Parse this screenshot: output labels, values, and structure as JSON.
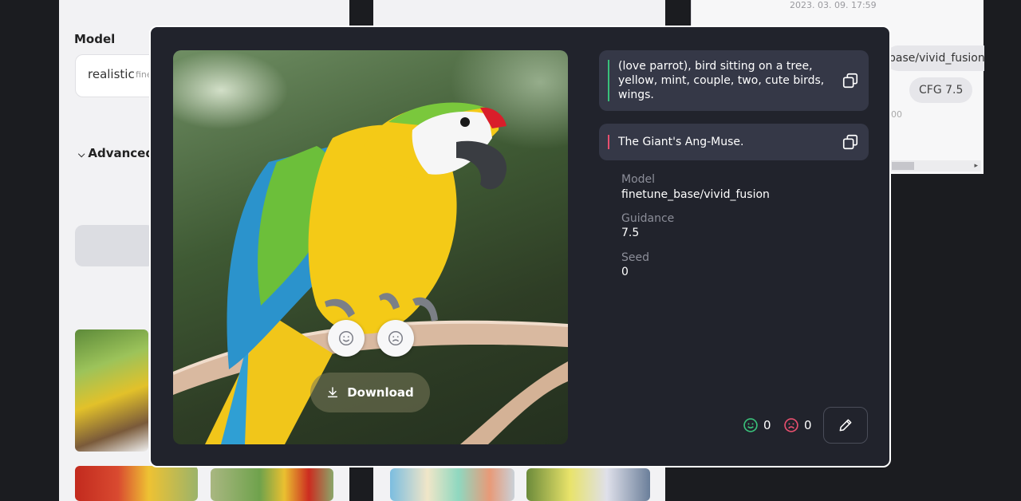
{
  "background": {
    "form": {
      "model_label": "Model",
      "model_value": "realistic",
      "model_sub": "fine",
      "advanced_label": "Advanced"
    },
    "history": {
      "date": "2023. 03. 09. 17:59",
      "model_chip": "base/vivid_fusion",
      "cfg_chip": "CFG 7.5",
      "number_fragment": "00"
    }
  },
  "modal": {
    "image_alt": "parrot",
    "like_icon": "smile-icon",
    "dislike_icon": "frown-icon",
    "download_label": "Download",
    "prompt": "(love parrot), bird sitting on a tree, yellow, mint, couple, two, cute birds, wings.",
    "negative_prompt": "The Giant's Ang-Muse.",
    "meta": {
      "model_label": "Model",
      "model_value": "finetune_base/vivid_fusion",
      "guidance_label": "Guidance",
      "guidance_value": "7.5",
      "seed_label": "Seed",
      "seed_value": "0"
    },
    "votes": {
      "likes": "0",
      "dislikes": "0"
    },
    "colors": {
      "accent_positive": "#39c07a",
      "accent_negative": "#e84f6e",
      "modal_bg": "#21232c",
      "box_bg": "#353847"
    }
  }
}
